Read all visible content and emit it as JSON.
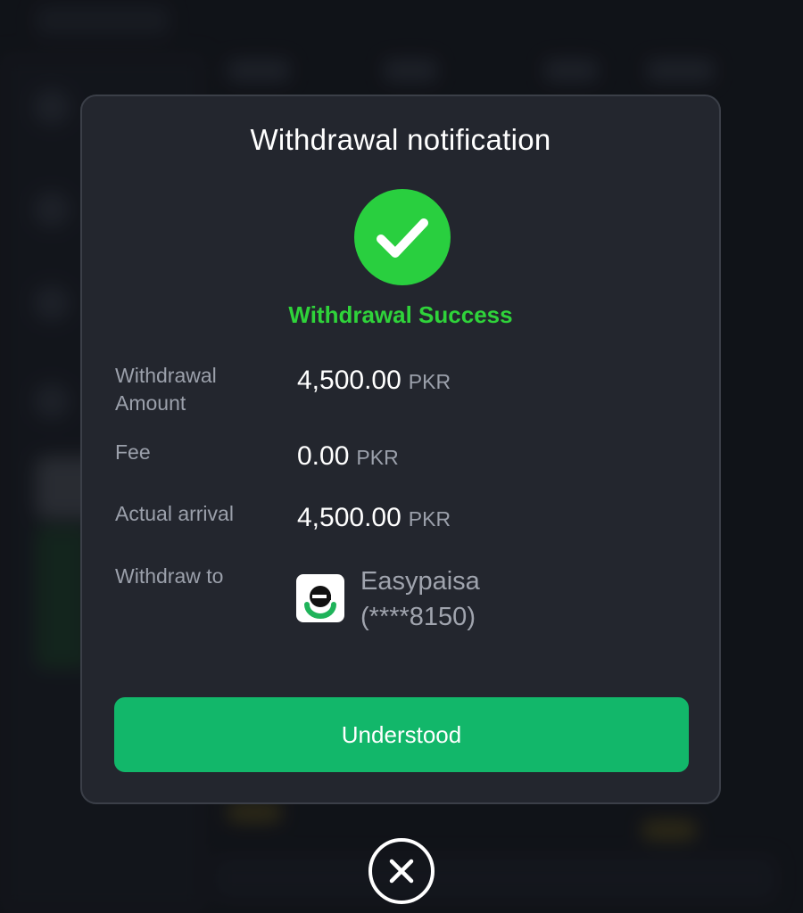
{
  "dialog": {
    "title": "Withdrawal notification",
    "status_text": "Withdrawal Success",
    "status_icon": "check-icon",
    "status_color": "#29cf3f",
    "rows": [
      {
        "label": "Withdrawal Amount",
        "value": "4,500.00",
        "unit": "PKR"
      },
      {
        "label": "Fee",
        "value": "0.00",
        "unit": "PKR"
      },
      {
        "label": "Actual arrival",
        "value": "4,500.00",
        "unit": "PKR"
      }
    ],
    "withdraw_to": {
      "label": "Withdraw to",
      "method": "Easypaisa",
      "account": "(****8150)",
      "logo_icon": "easypaisa-logo-icon"
    },
    "confirm_button": "Understood",
    "confirm_color": "#12b76a",
    "close_icon": "close-icon"
  }
}
